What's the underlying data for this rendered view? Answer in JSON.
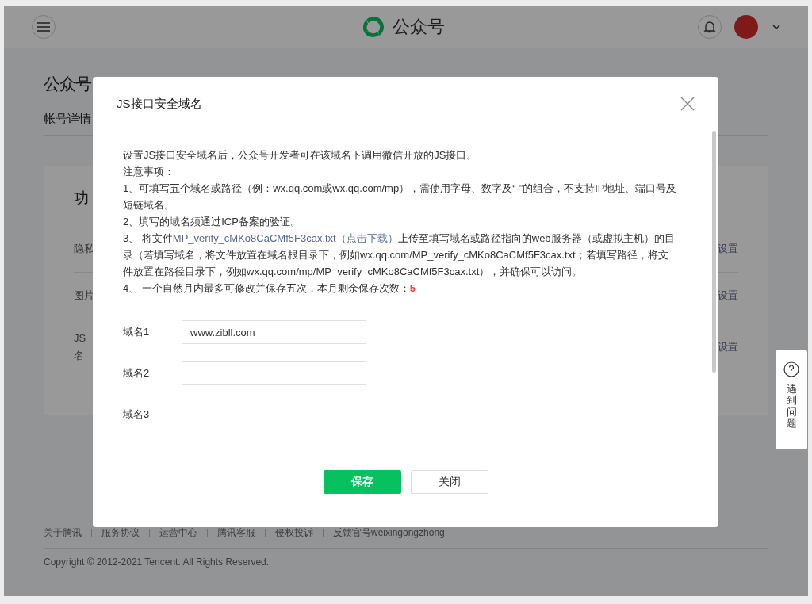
{
  "header": {
    "brand": "公众号"
  },
  "page": {
    "title": "公众号",
    "tabs": [
      {
        "label": "帐号详情",
        "selected": true
      }
    ]
  },
  "card": {
    "title": "功",
    "rows": [
      {
        "label_lines": [
          "隐私"
        ],
        "action": "设置"
      },
      {
        "label_lines": [
          "图片"
        ],
        "action": "设置"
      },
      {
        "label_lines": [
          "JS",
          "名"
        ],
        "action": "设置"
      }
    ]
  },
  "footer": {
    "links": [
      "关于腾讯",
      "服务协议",
      "运营中心",
      "腾讯客服",
      "侵权投诉",
      "反馈官号weixingongzhong"
    ],
    "copyright": "Copyright © 2012-2021 Tencent. All Rights Reserved."
  },
  "help_widget": {
    "label": "遇到问题"
  },
  "dialog": {
    "title": "JS接口安全域名",
    "notes": [
      [
        {
          "kind": "plain",
          "text": "设置JS接口安全域名后，公众号开发者可在该域名下调用微信开放的JS接口。"
        }
      ],
      [
        {
          "kind": "plain",
          "text": "注意事项："
        }
      ],
      [
        {
          "kind": "plain",
          "text": "1、可填写五个域名或路径（例：wx.qq.com或wx.qq.com/mp），需使用字母、数字及“-”的组合，不支持IP地址、端口号及短链域名。"
        }
      ],
      [
        {
          "kind": "plain",
          "text": "2、填写的域名须通过ICP备案的验证。"
        }
      ],
      [
        {
          "kind": "plain",
          "text": "3、 将文件"
        },
        {
          "kind": "link",
          "text": "MP_verify_cMKo8CaCMf5F3cax.txt（点击下载）"
        },
        {
          "kind": "plain",
          "text": "上传至填写域名或路径指向的web服务器（或虚拟主机）的目录（若填写域名，将文件放置在域名根目录下，例如wx.qq.com/MP_verify_cMKo8CaCMf5F3cax.txt；若填写路径，将文件放置在路径目录下，例如wx.qq.com/mp/MP_verify_cMKo8CaCMf5F3cax.txt），并确保可以访问。"
        }
      ],
      [
        {
          "kind": "plain",
          "text": "4、 一个自然月内最多可修改并保存五次，本月剩余保存次数："
        },
        {
          "kind": "count",
          "text": "5"
        }
      ]
    ],
    "fields": [
      {
        "label": "域名1",
        "value": "www.zibll.com"
      },
      {
        "label": "域名2"
      },
      {
        "label": "域名3"
      }
    ],
    "buttons": [
      {
        "label": "保存",
        "kind": "primary"
      },
      {
        "label": "关闭",
        "kind": "default"
      }
    ]
  }
}
